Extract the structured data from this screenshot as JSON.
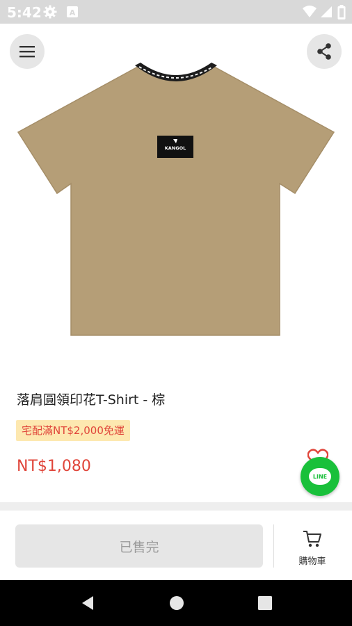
{
  "status_bar": {
    "time": "5:42",
    "icons": [
      "settings-icon",
      "a-icon",
      "wifi-icon",
      "signal-icon",
      "battery-icon"
    ]
  },
  "header": {
    "menu_icon": "hamburger-menu-icon",
    "share_icon": "share-icon"
  },
  "product": {
    "title": "落肩圓領印花T-Shirt - 棕",
    "promo_badge": "宅配滿NT$2,000免運",
    "price": "NT$1,080",
    "shirt_color": "#b59e77",
    "logo_text": "KANGOL"
  },
  "floating": {
    "line_label": "LINE",
    "heart_icon": "heart-icon"
  },
  "bottom_bar": {
    "soldout_label": "已售完",
    "cart_label": "購物車"
  },
  "nav_bar": {
    "icons": [
      "back-icon",
      "home-icon",
      "recents-icon"
    ]
  },
  "colors": {
    "price": "#e0453a",
    "badge_bg": "#fde8b0",
    "line_green": "#19c03a",
    "status_bar_bg": "#d9d9d9"
  }
}
